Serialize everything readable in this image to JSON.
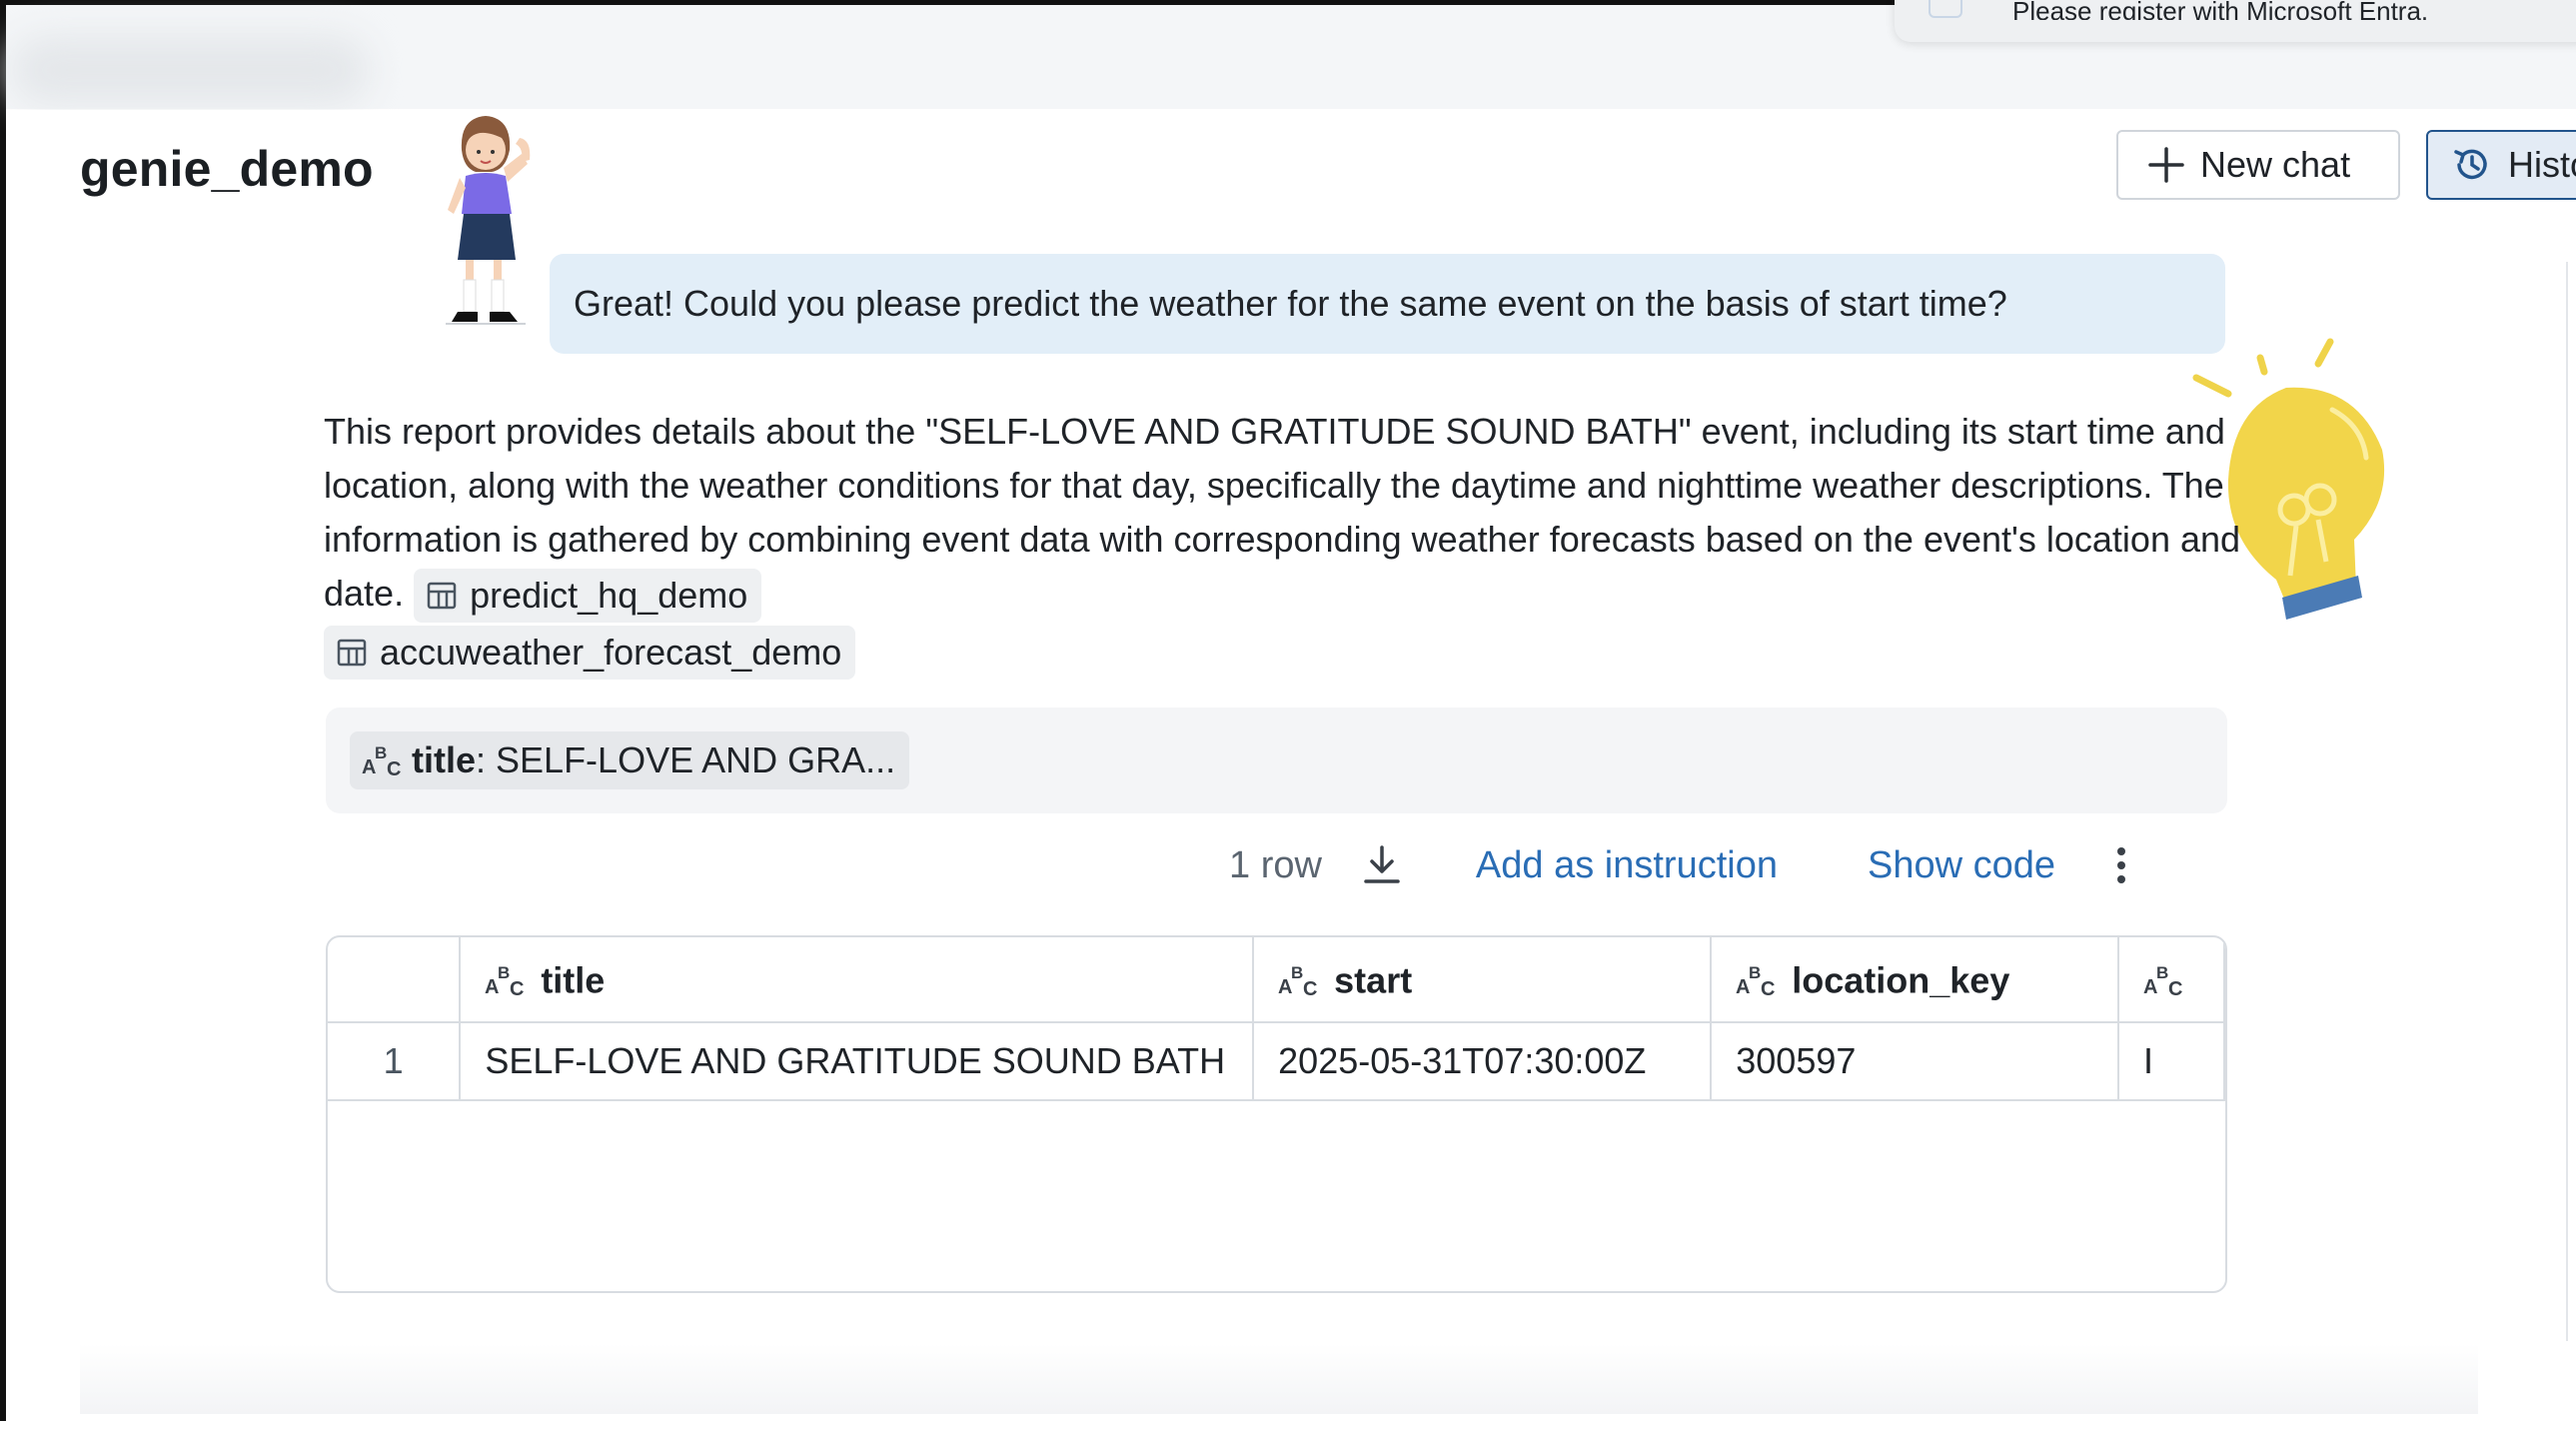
{
  "notification": {
    "text": "Please register with Microsoft Entra."
  },
  "header": {
    "title": "genie_demo",
    "new_chat_label": "New chat",
    "history_label": "History"
  },
  "conversation": {
    "user_message": "Great! Could you please predict the weather for the same event on the basis of start time?",
    "answer_text": "This report provides details about the \"SELF-LOVE AND GRATITUDE SOUND BATH\" event, including its start time and location, along with the weather conditions for that day, specifically the daytime and nighttime weather descriptions. The information is gathered by combining event data with corresponding weather forecasts based on the event's location and date.",
    "tables_used": [
      "predict_hq_demo",
      "accuweather_forecast_demo"
    ]
  },
  "filter": {
    "field": "title",
    "value": ": SELF-LOVE AND GRA..."
  },
  "result_actions": {
    "row_count": "1 row",
    "add_instruction": "Add as instruction",
    "show_code": "Show code"
  },
  "result_table": {
    "columns": [
      "title",
      "start",
      "location_key",
      ""
    ],
    "rows": [
      {
        "index": "1",
        "cells": [
          "SELF-LOVE AND GRATITUDE SOUND BATH",
          "2025-05-31T07:30:00Z",
          "300597",
          "I"
        ]
      }
    ]
  },
  "colors": {
    "accent_link": "#2a6db5",
    "user_bubble": "#e2eef8",
    "history_button_bg": "#e3ebf5",
    "history_button_border": "#22548c"
  },
  "icons": {
    "new_chat": "plus-icon",
    "history": "history-clock-icon",
    "table": "table-icon",
    "string_type": "abc-type-icon",
    "download": "download-icon",
    "more": "kebab-menu-icon"
  }
}
